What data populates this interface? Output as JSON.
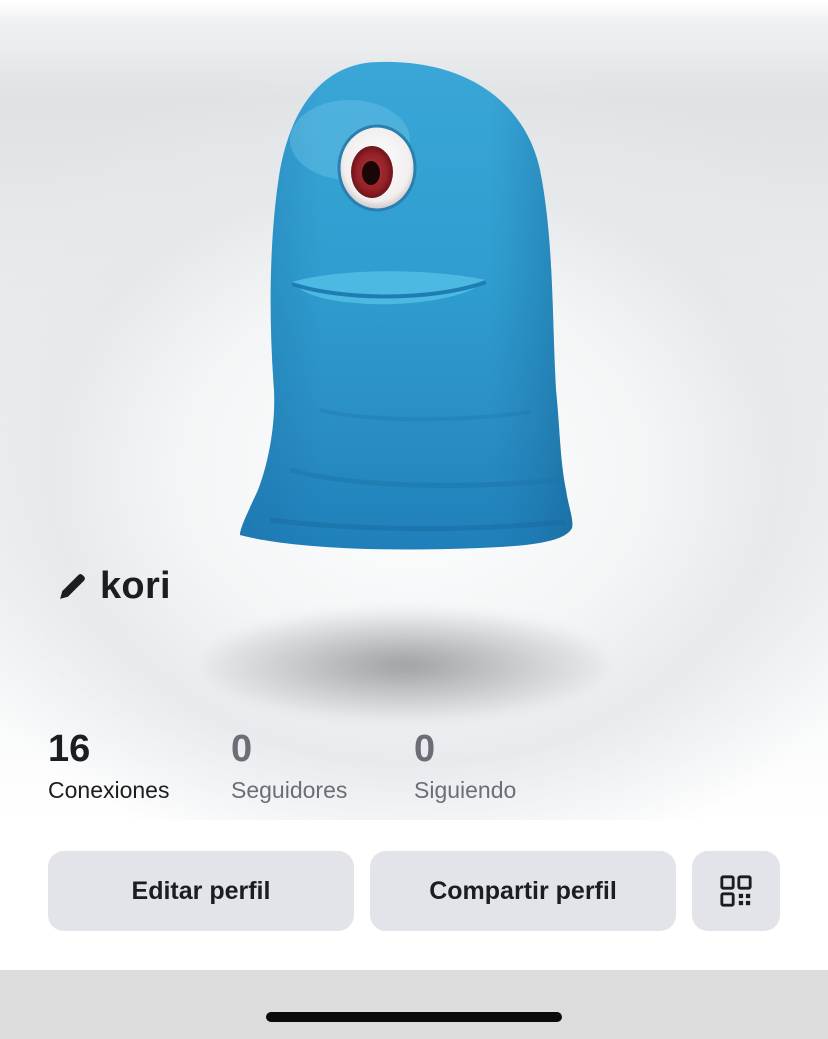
{
  "profile": {
    "username": "kori",
    "avatar_description_icon": "blue-one-eyed-blob-avatar"
  },
  "stats": [
    {
      "value": "16",
      "label": "Conexiones"
    },
    {
      "value": "0",
      "label": "Seguidores"
    },
    {
      "value": "0",
      "label": "Siguiendo"
    }
  ],
  "actions": {
    "edit_label": "Editar perfil",
    "share_label": "Compartir perfil",
    "qr_icon": "qr-code-icon"
  },
  "icons": {
    "edit": "pencil-icon"
  },
  "colors": {
    "avatar_blue": "#2f9fd0",
    "button_bg": "#e3e4e9",
    "text_primary": "#1c1d20",
    "text_muted": "#6c6e77",
    "bottom_bar": "#dcdcdc"
  }
}
